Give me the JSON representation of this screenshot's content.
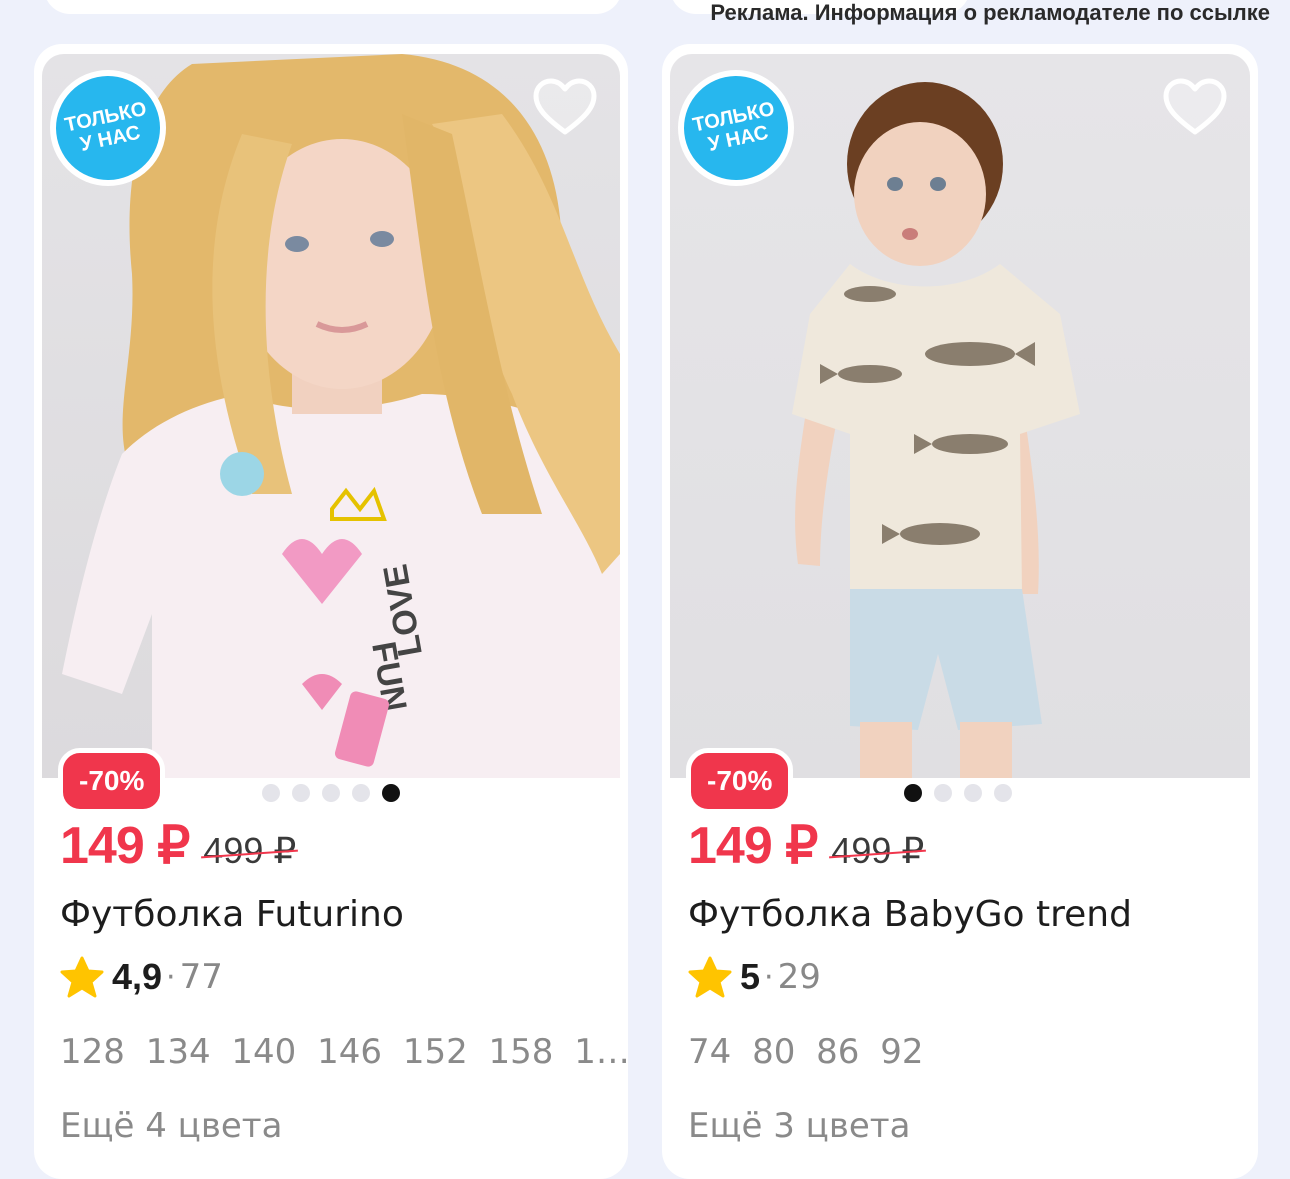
{
  "ad_notice": "Реклама. Информация о рекламодателе по ссылке",
  "products": [
    {
      "badge_line1": "ТОЛЬКО",
      "badge_line2": "У НАС",
      "discount": "-70%",
      "price_now": "149 ₽",
      "price_old": "499 ₽",
      "title": "Футболка Futurino",
      "rating": "4,9",
      "reviews": "77",
      "sizes": "128  134  140  146  152  158  1…",
      "more_colors": "Ещё 4 цвета",
      "slides_total": 5,
      "slide_active": 5,
      "favorite_icon": "heart-outline-icon",
      "photo_alt": "Девочка в футболке"
    },
    {
      "badge_line1": "ТОЛЬКО",
      "badge_line2": "У НАС",
      "discount": "-70%",
      "price_now": "149 ₽",
      "price_old": "499 ₽",
      "title": "Футболка BabyGo trend",
      "rating": "5",
      "reviews": "29",
      "sizes": "74  80  86  92",
      "more_colors": "Ещё 3 цвета",
      "slides_total": 4,
      "slide_active": 1,
      "favorite_icon": "heart-outline-icon",
      "photo_alt": "Мальчик в футболке с рыбами"
    }
  ],
  "colors": {
    "accent_red": "#f0364c",
    "badge_blue": "#27b7ee",
    "star_yellow": "#ffc400",
    "background": "#eef1fb"
  }
}
